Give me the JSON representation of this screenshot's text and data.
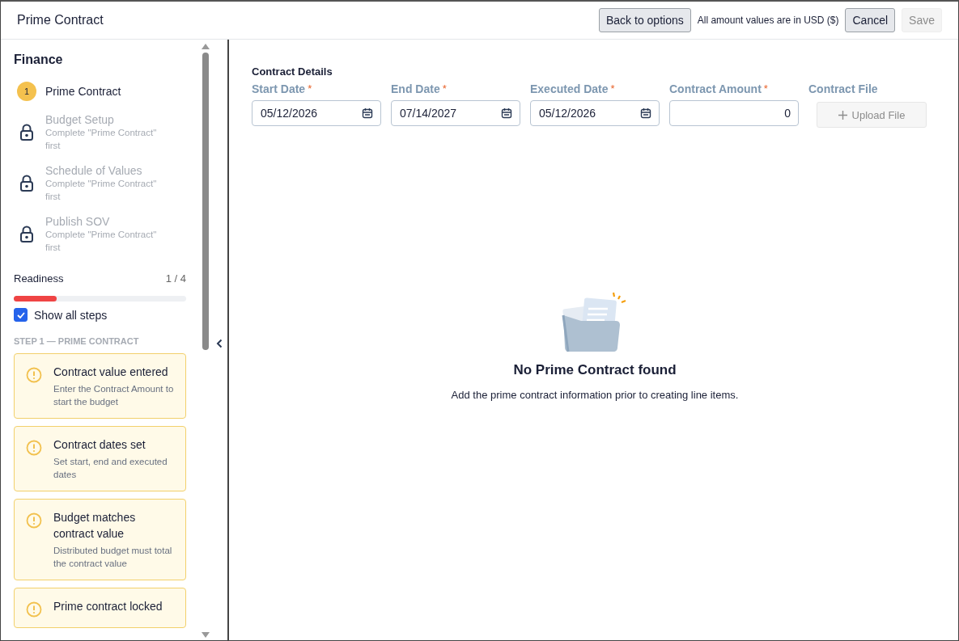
{
  "window": {
    "title": "Prime Contract"
  },
  "header": {
    "back_button": "Back to options",
    "note": "All amount values are in USD ($)",
    "cancel_button": {
      "label": "Cancel",
      "disabled": false
    },
    "save_button": {
      "label": "Save",
      "disabled": true
    }
  },
  "sidebar": {
    "title": "Finance",
    "steps": [
      {
        "kind": "current",
        "number": "1",
        "title": "Prime Contract"
      },
      {
        "kind": "locked",
        "title": "Budget Setup",
        "subtitle": "Complete \"Prime Contract\" first"
      },
      {
        "kind": "locked",
        "title": "Schedule of Values",
        "subtitle": "Complete \"Prime Contract\" first"
      },
      {
        "kind": "locked",
        "title": "Publish SOV",
        "subtitle": "Complete \"Prime Contract\" first"
      }
    ],
    "readiness": {
      "label": "Readiness",
      "count": "1 / 4",
      "level": 0.25
    },
    "show_all_steps": {
      "label": "Show all steps",
      "checked": true
    },
    "section_heading": "STEP 1 — PRIME CONTRACT",
    "checks": [
      {
        "kind": "warning",
        "title": "Contract value entered",
        "description": "Enter the Contract Amount to start the budget"
      },
      {
        "kind": "warning",
        "title": "Contract dates set",
        "description": "Set start, end and executed dates"
      },
      {
        "kind": "warning",
        "title": "Budget matches contract value",
        "description": "Distributed budget must total the contract value"
      },
      {
        "kind": "warning",
        "title": "Prime contract locked"
      }
    ]
  },
  "contract_details": {
    "title": "Contract Details",
    "fields": [
      {
        "kind": "date",
        "label": "Start Date",
        "required_mark": "*",
        "value": "05/12/2026"
      },
      {
        "kind": "date",
        "label": "End Date",
        "required_mark": "*",
        "value": "07/14/2027"
      },
      {
        "kind": "date",
        "label": "Executed Date",
        "required_mark": "*",
        "value": "05/12/2026"
      },
      {
        "kind": "amount",
        "label": "Contract Amount",
        "required_mark": "*",
        "value": "0"
      },
      {
        "kind": "file",
        "label": "Contract File",
        "button": "Upload File",
        "disabled": true
      }
    ]
  },
  "empty_state": {
    "title": "No Prime Contract found",
    "message": "Add the prime contract information prior to creating line items."
  }
}
